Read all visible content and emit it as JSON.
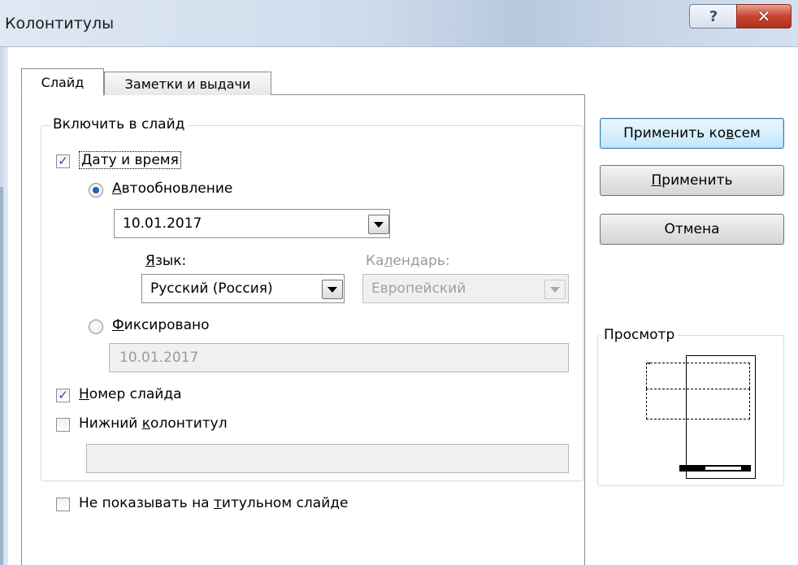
{
  "window": {
    "title": "Колонтитулы",
    "help_glyph": "?",
    "close_glyph": "✕"
  },
  "tabs": [
    {
      "label": "Слайд",
      "active": true
    },
    {
      "label": "Заметки и выдачи",
      "active": false
    }
  ],
  "include_group": {
    "legend": "Включить в слайд",
    "date_time": {
      "pre": "",
      "acc": "Д",
      "post": "ату и время",
      "checked": true
    },
    "auto_update": {
      "pre": "",
      "acc": "А",
      "post": "втообновление",
      "selected": true
    },
    "auto_date_value": "10.01.2017",
    "language": {
      "label_pre": "",
      "label_acc": "Я",
      "label_post": "зык:",
      "value": "Русский (Россия)"
    },
    "calendar": {
      "label_pre": "Ка",
      "label_acc": "л",
      "label_post": "ендарь:",
      "value": "Европейский",
      "disabled": true
    },
    "fixed": {
      "pre": "",
      "acc": "Ф",
      "post": "иксировано",
      "selected": false
    },
    "fixed_value": "10.01.2017",
    "slide_number": {
      "pre": "",
      "acc": "Н",
      "post": "омер слайда",
      "checked": true
    },
    "footer": {
      "pre": "Нижний ",
      "acc": "к",
      "post": "олонтитул",
      "checked": false
    },
    "footer_value": ""
  },
  "hide_on_title": {
    "pre": "Не показывать на ",
    "acc": "т",
    "post": "итульном слайде",
    "checked": false
  },
  "buttons": {
    "apply_all": {
      "pre": "Применить ко ",
      "acc": "в",
      "post": "сем"
    },
    "apply": {
      "pre": "",
      "acc": "П",
      "post": "рименить"
    },
    "cancel": {
      "pre": "",
      "acc": "",
      "post": "Отмена"
    }
  },
  "preview": {
    "legend": "Просмотр"
  },
  "check_glyph": "✓",
  "colors": {
    "check": "#1b4f9c",
    "radio_dot": "#1f5fbf",
    "close_red": "#c9452f",
    "default_button_border": "#3c7fb1"
  }
}
